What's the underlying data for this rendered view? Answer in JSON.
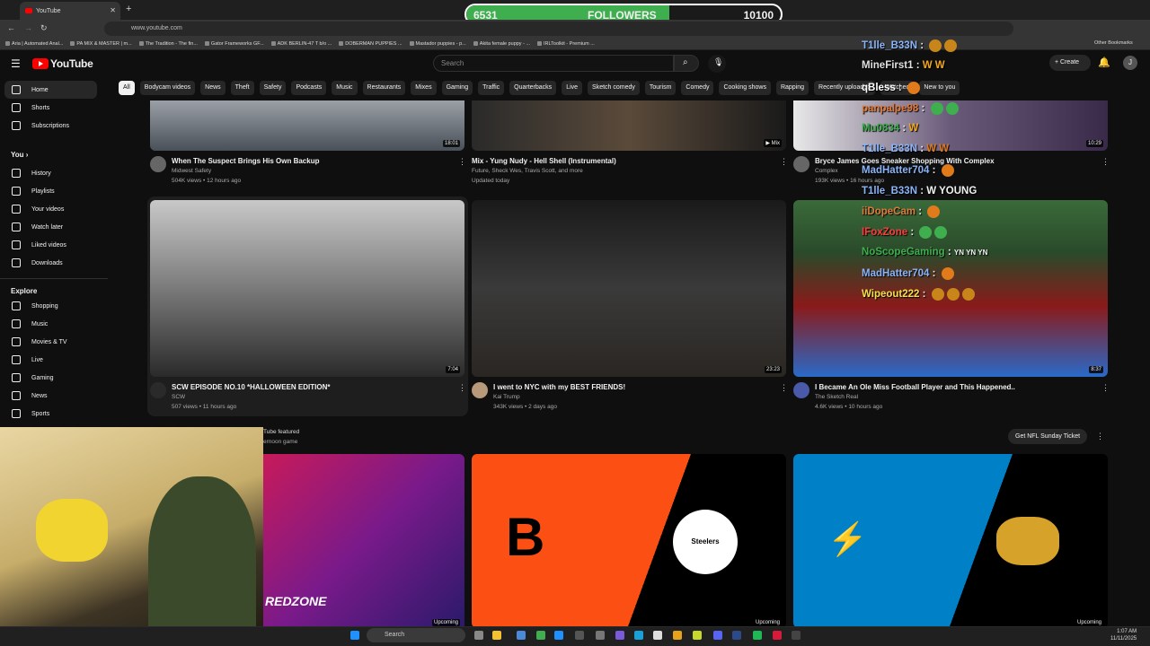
{
  "browser": {
    "tab_title": "YouTube",
    "url": "www.youtube.com",
    "bookmarks": [
      "Aria | Automated Anal...",
      "PA MIX & MASTER | m...",
      "The Tradition - The fin...",
      "Gator Frameworks GF...",
      "ADK BERLIN-47 T b/o ...",
      "DOBERMAN PUPPIES ...",
      "Mastador puppies - p...",
      "Akita female puppy - ...",
      "IRLToolkit - Premium ..."
    ],
    "other_bookmarks": "Other Bookmarks"
  },
  "followers": {
    "current": "6531",
    "label": "FOLLOWERS",
    "goal": "10100",
    "progress": 0.6467
  },
  "header": {
    "logo_text": "YouTube",
    "search_placeholder": "Search",
    "create_label": "Create",
    "avatar_letter": "J"
  },
  "chips": [
    "All",
    "Bodycam videos",
    "News",
    "Theft",
    "Safety",
    "Podcasts",
    "Music",
    "Restaurants",
    "Mixes",
    "Gaming",
    "Traffic",
    "Quarterbacks",
    "Live",
    "Sketch comedy",
    "Tourism",
    "Comedy",
    "Cooking shows",
    "Rapping",
    "Recently uploaded",
    "Watched",
    "New to you"
  ],
  "sidebar": {
    "top": [
      "Home",
      "Shorts",
      "Subscriptions"
    ],
    "you_heading": "You",
    "you": [
      "History",
      "Playlists",
      "Your videos",
      "Watch later",
      "Liked videos",
      "Downloads"
    ],
    "explore_heading": "Explore",
    "explore": [
      "Shopping",
      "Music",
      "Movies & TV",
      "Live",
      "Gaming",
      "News",
      "Sports"
    ]
  },
  "videos_row1": [
    {
      "duration": "18:01",
      "title": "When The Suspect Brings His Own Backup",
      "channel": "Midwest Safety",
      "meta": "504K views • 12 hours ago"
    },
    {
      "duration": "Mix",
      "title": "Mix - Yung Nudy - Hell Shell (Instrumental)",
      "channel": "Future, Sheck Wes, Travis Scott, and more",
      "meta": "Updated today"
    },
    {
      "duration": "10:29",
      "title": "Bryce James Goes Sneaker Shopping With Complex",
      "channel": "Complex",
      "meta": "193K views • 16 hours ago"
    }
  ],
  "videos_row2": [
    {
      "duration": "7:04",
      "title": "SCW EPISODE NO.10 *HALLOWEEN EDITION*",
      "channel": "SCW",
      "meta": "507 views • 11 hours ago"
    },
    {
      "duration": "23:23",
      "title": "I went to NYC with my BEST FRIENDS!",
      "channel": "Kai Trump",
      "meta": "343K views • 2 days ago"
    },
    {
      "duration": "8:37",
      "title": "I Became An Ole Miss Football Player and This Happened..",
      "channel": "The Sketch Real",
      "meta": "4.6K views • 10 hours ago"
    }
  ],
  "featured": {
    "line1": "Tube featured",
    "line2": "ernoon game",
    "button": "Get NFL Sunday Ticket",
    "cards": [
      {
        "badge": "Upcoming",
        "logo_text": "REDZONE"
      },
      {
        "badge": "Upcoming",
        "logo_text": "Steelers"
      },
      {
        "badge": "Upcoming",
        "logo_text": ""
      }
    ]
  },
  "chat": [
    {
      "user": "T1lle_B33N",
      "msg": "",
      "color": "#8ab4f8"
    },
    {
      "user": "MineFirst1",
      "msg": "W  W",
      "color": "#e0e0e0"
    },
    {
      "user": "qBless",
      "msg": "",
      "color": "#ffffff"
    },
    {
      "user": "panpalpe98",
      "msg": "",
      "color": "#e07a3a"
    },
    {
      "user": "Mu0834",
      "msg": "W",
      "color": "#3fae4f"
    },
    {
      "user": "T1lle_B33N",
      "msg": "W  W",
      "color": "#8ab4f8"
    },
    {
      "user": "MadHatter704",
      "msg": "",
      "color": "#8ab4f8"
    },
    {
      "user": "T1lle_B33N",
      "msg": "W YOUNG",
      "color": "#8ab4f8"
    },
    {
      "user": "iiDopeCam",
      "msg": "",
      "color": "#e07a3a"
    },
    {
      "user": "IFoxZone",
      "msg": "",
      "color": "#ff3b3b"
    },
    {
      "user": "NoScopeGaming",
      "msg": "YN  YN  YN",
      "color": "#3fae4f"
    },
    {
      "user": "MadHatter704",
      "msg": "",
      "color": "#8ab4f8"
    },
    {
      "user": "Wipeout222",
      "msg": "",
      "color": "#f2e04a"
    }
  ],
  "taskbar": {
    "search": "Search",
    "time": "1:07 AM",
    "date": "11/11/2025"
  }
}
